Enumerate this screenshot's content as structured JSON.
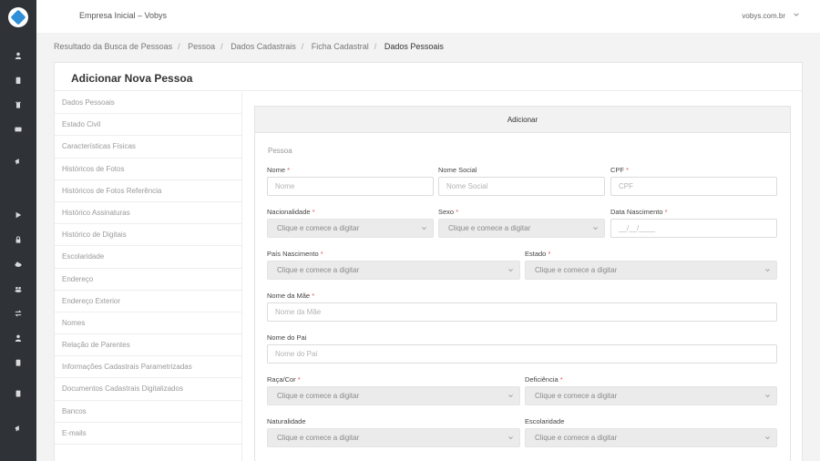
{
  "header": {
    "title": "Empresa Inicial – Vobys",
    "domain": "vobys.com.br"
  },
  "breadcrumb": [
    "Resultado da Busca de Pessoas",
    "Pessoa",
    "Dados Cadastrais",
    "Ficha Cadastral",
    "Dados Pessoais"
  ],
  "card": {
    "title": "Adicionar Nova Pessoa"
  },
  "menu": [
    "Dados Pessoais",
    "Estado Civil",
    "Características Físicas",
    "Históricos de Fotos",
    "Históricos de Fotos Referência",
    "Histórico Assinaturas",
    "Histórico de Digitais",
    "Escolaridade",
    "Endereço",
    "Endereço Exterior",
    "Nomes",
    "Relação de Parentes",
    "Informações Cadastrais Parametrizadas",
    "Documentos Cadastrais Digitalizados",
    "Bancos",
    "E-mails"
  ],
  "panel": {
    "title": "Adicionar",
    "section": "Pessoa"
  },
  "form": {
    "nome": {
      "label": "Nome",
      "placeholder": "Nome"
    },
    "nome_social": {
      "label": "Nome Social",
      "placeholder": "Nome Social"
    },
    "cpf": {
      "label": "CPF",
      "placeholder": "CPF"
    },
    "nacionalidade": {
      "label": "Nacionalidade",
      "placeholder": "Clique e comece a digitar"
    },
    "sexo": {
      "label": "Sexo",
      "placeholder": "Clique e comece a digitar"
    },
    "data_nascimento": {
      "label": "Data Nascimento",
      "placeholder": "__/__/____"
    },
    "pais_nascimento": {
      "label": "País Nascimento",
      "placeholder": "Clique e comece a digitar"
    },
    "estado": {
      "label": "Estado",
      "placeholder": "Clique e comece a digitar"
    },
    "nome_mae": {
      "label": "Nome da Mãe",
      "placeholder": "Nome da Mãe"
    },
    "nome_pai": {
      "label": "Nome do Pai",
      "placeholder": "Nome do Pai"
    },
    "raca_cor": {
      "label": "Raça/Cor",
      "placeholder": "Clique e comece a digitar"
    },
    "deficiencia": {
      "label": "Deficiência",
      "placeholder": "Clique e comece a digitar"
    },
    "naturalidade": {
      "label": "Naturalidade",
      "placeholder": "Clique e comece a digitar"
    },
    "escolaridade": {
      "label": "Escolaridade",
      "placeholder": "Clique e comece a digitar"
    },
    "required_mark": "*"
  },
  "icons": {
    "logo": "vobys-logo-icon",
    "rail": [
      "user-icon",
      "clipboard-icon",
      "trash-icon",
      "card-icon",
      "megaphone-icon",
      "play-icon",
      "lock-icon",
      "cloud-upload-icon",
      "group-icon",
      "transfer-icon",
      "user-icon",
      "document-icon",
      "calculator-icon",
      "megaphone-icon"
    ]
  },
  "colors": {
    "sidebar": "#2f3338",
    "required": "#e05555",
    "logo_accent": "#2f8fd8"
  }
}
